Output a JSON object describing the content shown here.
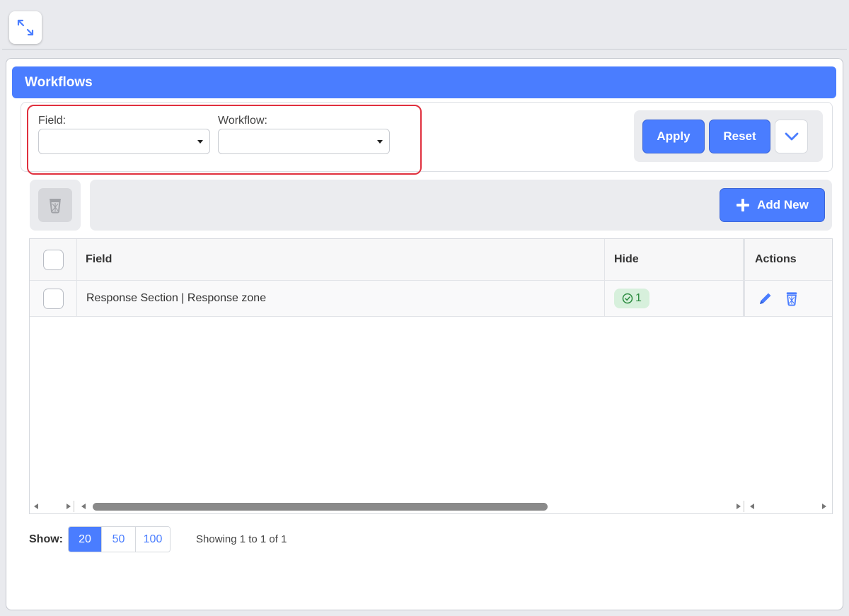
{
  "topbar": {
    "expand_icon": "expand-arrows-icon"
  },
  "panel": {
    "title": "Workflows"
  },
  "filters": {
    "field": {
      "label": "Field:",
      "value": ""
    },
    "workflow": {
      "label": "Workflow:",
      "value": ""
    },
    "apply_label": "Apply",
    "reset_label": "Reset",
    "toggle_icon": "chevron-down-icon"
  },
  "toolbar": {
    "delete_icon": "trash-icon",
    "add_new_label": "Add New",
    "add_icon": "plus-icon"
  },
  "table": {
    "columns": [
      "Field",
      "Hide",
      "Actions"
    ],
    "rows": [
      {
        "field": "Response Section | Response zone",
        "hide_count": "1",
        "hide_icon": "check-circle-icon"
      }
    ]
  },
  "pagination": {
    "show_label": "Show:",
    "page_sizes": [
      "20",
      "50",
      "100"
    ],
    "selected_size": "20",
    "summary": "Showing 1 to 1 of 1"
  },
  "colors": {
    "accent": "#4a7dff",
    "highlight": "#e0303e",
    "badge_bg": "#d7f0dc",
    "badge_text": "#2a8a3e"
  }
}
